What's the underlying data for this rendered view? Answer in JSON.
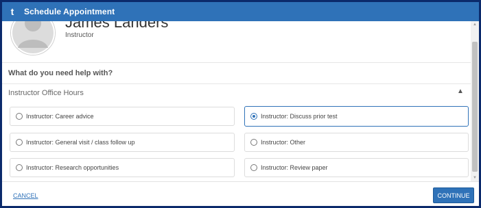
{
  "window": {
    "title": "Schedule Appointment",
    "logo_glyph": "t"
  },
  "instructor": {
    "name": "James Landers",
    "role": "Instructor"
  },
  "question": "What do you need help with?",
  "section": {
    "title": "Instructor Office Hours",
    "expanded": true
  },
  "options": [
    {
      "label": "Instructor: Career advice",
      "selected": false
    },
    {
      "label": "Instructor: Discuss prior test",
      "selected": true
    },
    {
      "label": "Instructor: General visit / class follow up",
      "selected": false
    },
    {
      "label": "Instructor: Other",
      "selected": false
    },
    {
      "label": "Instructor: Research opportunities",
      "selected": false
    },
    {
      "label": "Instructor: Review paper",
      "selected": false
    }
  ],
  "footer": {
    "cancel_label": "CANCEL",
    "continue_label": "CONTINUE"
  },
  "colors": {
    "accent": "#2f72b8",
    "frame_border": "#0b2a6b"
  }
}
